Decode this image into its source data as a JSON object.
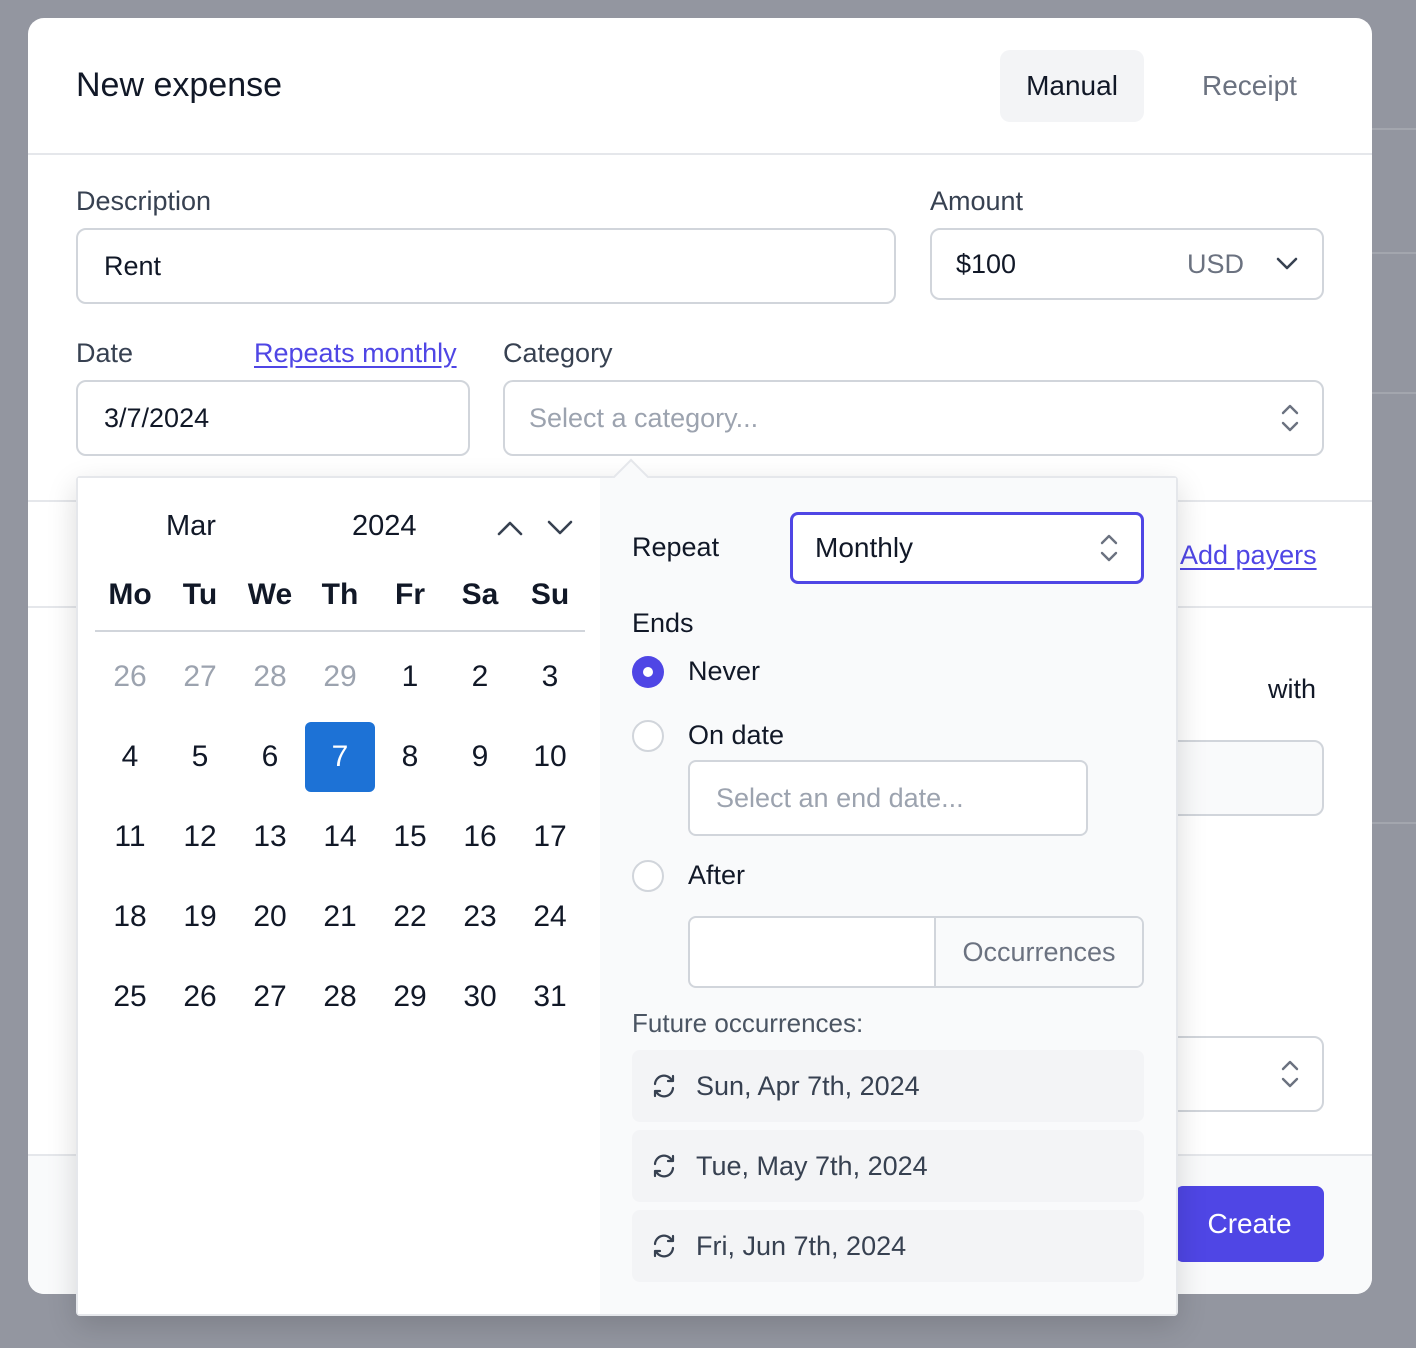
{
  "modal": {
    "title": "New expense",
    "tabs": [
      {
        "label": "Manual",
        "active": true
      },
      {
        "label": "Receipt",
        "active": false
      }
    ]
  },
  "form": {
    "description": {
      "label": "Description",
      "value": "Rent"
    },
    "amount": {
      "label": "Amount",
      "value": "$100",
      "currency": "USD"
    },
    "date": {
      "label": "Date",
      "value": "3/7/2024",
      "repeat_link": "Repeats monthly"
    },
    "category": {
      "label": "Category",
      "placeholder": "Select a category..."
    },
    "add_payers_link": "Add payers",
    "split_with_label": "with"
  },
  "footer": {
    "create_label": "Create"
  },
  "calendar": {
    "month": "Mar",
    "year": "2024",
    "weekdays": [
      "Mo",
      "Tu",
      "We",
      "Th",
      "Fr",
      "Sa",
      "Su"
    ],
    "weeks": [
      [
        {
          "d": "26",
          "m": true
        },
        {
          "d": "27",
          "m": true
        },
        {
          "d": "28",
          "m": true
        },
        {
          "d": "29",
          "m": true
        },
        {
          "d": "1"
        },
        {
          "d": "2"
        },
        {
          "d": "3"
        }
      ],
      [
        {
          "d": "4"
        },
        {
          "d": "5"
        },
        {
          "d": "6"
        },
        {
          "d": "7",
          "s": true
        },
        {
          "d": "8"
        },
        {
          "d": "9"
        },
        {
          "d": "10"
        }
      ],
      [
        {
          "d": "11"
        },
        {
          "d": "12"
        },
        {
          "d": "13"
        },
        {
          "d": "14"
        },
        {
          "d": "15"
        },
        {
          "d": "16"
        },
        {
          "d": "17"
        }
      ],
      [
        {
          "d": "18"
        },
        {
          "d": "19"
        },
        {
          "d": "20"
        },
        {
          "d": "21"
        },
        {
          "d": "22"
        },
        {
          "d": "23"
        },
        {
          "d": "24"
        }
      ],
      [
        {
          "d": "25"
        },
        {
          "d": "26"
        },
        {
          "d": "27"
        },
        {
          "d": "28"
        },
        {
          "d": "29"
        },
        {
          "d": "30"
        },
        {
          "d": "31"
        }
      ]
    ]
  },
  "repeat": {
    "label": "Repeat",
    "value": "Monthly",
    "ends_label": "Ends",
    "options": [
      {
        "label": "Never",
        "checked": true
      },
      {
        "label": "On date",
        "checked": false
      },
      {
        "label": "After",
        "checked": false
      }
    ],
    "end_date_placeholder": "Select an end date...",
    "occurrences_addon": "Occurrences",
    "occurrences_value": "",
    "future_label": "Future occurrences:",
    "future": [
      "Sun, Apr 7th, 2024",
      "Tue, May 7th, 2024",
      "Fri, Jun 7th, 2024"
    ]
  },
  "icons": {
    "chevron": "chevron-down-icon",
    "updown": "chevrons-up-down-icon",
    "repeat": "refresh-icon"
  },
  "colors": {
    "accent": "#4f46e5",
    "selected_day": "#1d72d6",
    "overlay": "#9396a0"
  }
}
